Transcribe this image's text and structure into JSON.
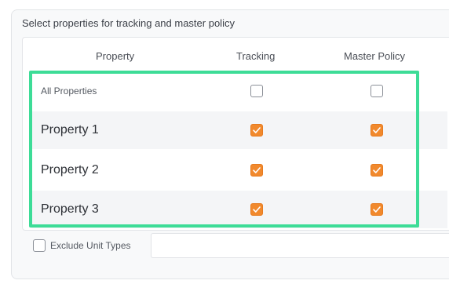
{
  "section": {
    "title": "Select properties for tracking and master policy"
  },
  "table": {
    "columns": [
      "Property",
      "Tracking",
      "Master Policy"
    ],
    "rows": [
      {
        "label": "All Properties",
        "tracking": false,
        "master_policy": false
      },
      {
        "label": "Property 1",
        "tracking": true,
        "master_policy": true
      },
      {
        "label": "Property 2",
        "tracking": true,
        "master_policy": true
      },
      {
        "label": "Property 3",
        "tracking": true,
        "master_policy": true
      }
    ]
  },
  "exclude": {
    "label": "Exclude Unit Types",
    "checked": false,
    "input_value": ""
  },
  "colors": {
    "accent": "#f1892d",
    "highlight": "#3ddc97"
  }
}
